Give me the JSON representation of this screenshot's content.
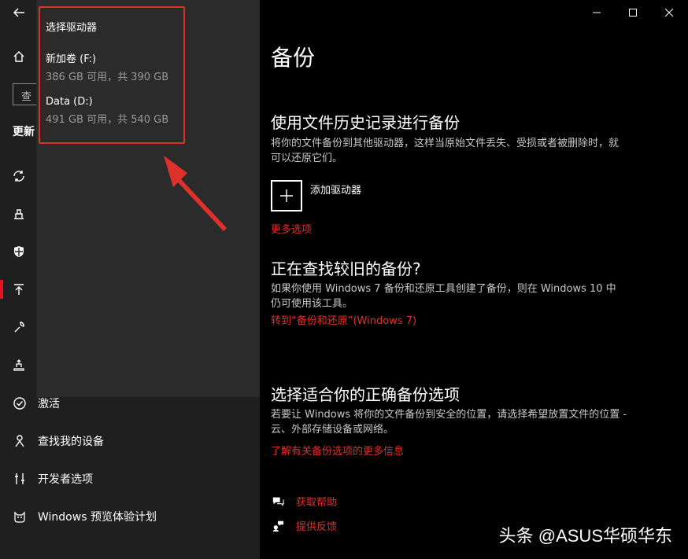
{
  "colors": {
    "accent": "#e0302a",
    "background": "#000000",
    "pane": "#1f1f1f",
    "flyout": "#2b2b2b"
  },
  "rail": {
    "search_placeholder": "查",
    "section_label": "更新",
    "icons": [
      "back-icon",
      "home-icon",
      "sync-icon",
      "delivery-icon",
      "shield-icon",
      "backup-icon",
      "wrench-icon",
      "recovery-icon"
    ]
  },
  "flyout": {
    "title": "选择驱动器",
    "drives": [
      {
        "name": "新加卷 (F:)",
        "size": "386 GB 可用，共 390 GB"
      },
      {
        "name": "Data (D:)",
        "size": "491 GB 可用，共 540 GB"
      }
    ]
  },
  "nav": {
    "items": [
      {
        "label": "激活",
        "icon": "check-circle-icon"
      },
      {
        "label": "查找我的设备",
        "icon": "person-location-icon"
      },
      {
        "label": "开发者选项",
        "icon": "developer-icon"
      },
      {
        "label": "Windows 预览体验计划",
        "icon": "insider-icon"
      }
    ]
  },
  "main": {
    "title": "备份",
    "section1": {
      "heading": "使用文件历史记录进行备份",
      "description": "将你的文件备份到其他驱动器，这样当原始文件丢失、受损或者被删除时，就可以还原它们。",
      "add_drive": "添加驱动器",
      "more_options": "更多选项"
    },
    "section2": {
      "heading": "正在查找较旧的备份?",
      "description": "如果你使用 Windows 7 备份和还原工具创建了备份，则在 Windows 10 中仍可使用该工具。",
      "link": "转到“备份和还原”(Windows 7)"
    },
    "section3": {
      "heading": "选择适合你的正确备份选项",
      "description": "若要让 Windows 将你的文件备份到安全的位置，请选择希望放置文件的位置 - 云、外部存储设备或网络。",
      "link": "了解有关备份选项的更多信息"
    },
    "footer": {
      "help": "获取帮助",
      "feedback": "提供反馈"
    }
  },
  "watermark": "头条 @ASUS华硕华东"
}
